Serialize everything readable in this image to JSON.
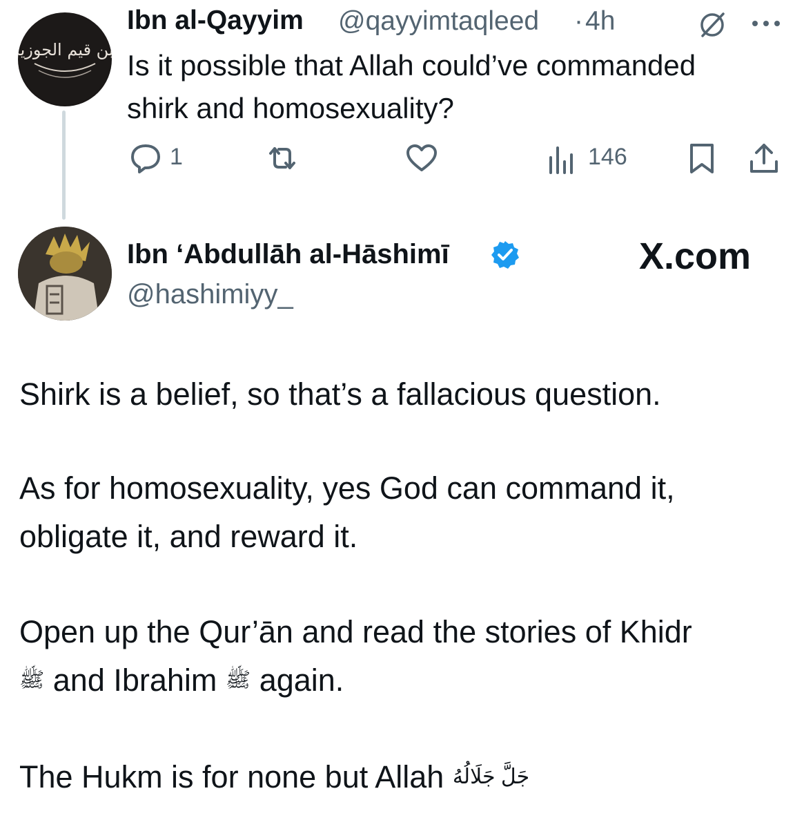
{
  "reply_to": {
    "name": "Ibn al-Qayyim",
    "handle": "@qayyimtaqleed",
    "dot": "·",
    "time": "4h",
    "text_line1": "Is it possible that Allah could’ve commanded",
    "text_line2": "shirk and homosexuality?",
    "avatar_text": "ابن قيم الجوزية",
    "metrics": {
      "replies": "1",
      "views": "146"
    },
    "icons": [
      "reply-icon",
      "retweet-icon",
      "like-icon",
      "views-icon",
      "bookmark-icon",
      "share-icon",
      "grok-icon",
      "more-icon"
    ]
  },
  "tweet": {
    "name": "Ibn ‘Abdullāh al-Hāshimī",
    "handle": "@hashimiyy_",
    "watermark": "X.com",
    "para1": "Shirk is a belief, so that’s a fallacious question.",
    "para2_line1": "As for homosexuality, yes God can command it,",
    "para2_line2": "obligate it, and reward it.",
    "para3_line1": "Open up the Qur’ān and read the stories of Khidr",
    "para3_line2a": "and Ibrahim",
    "para3_line2b": "again.",
    "honorific_saw": "ﷺ",
    "para4": "The Hukm is for none but Allah",
    "honorific_jalla": "جَلَّ جَلَالُهُ"
  },
  "colors": {
    "text": "#0f1419",
    "secondary": "#536471",
    "verified": "#1d9bf0",
    "thread_line": "#cfd9de"
  }
}
